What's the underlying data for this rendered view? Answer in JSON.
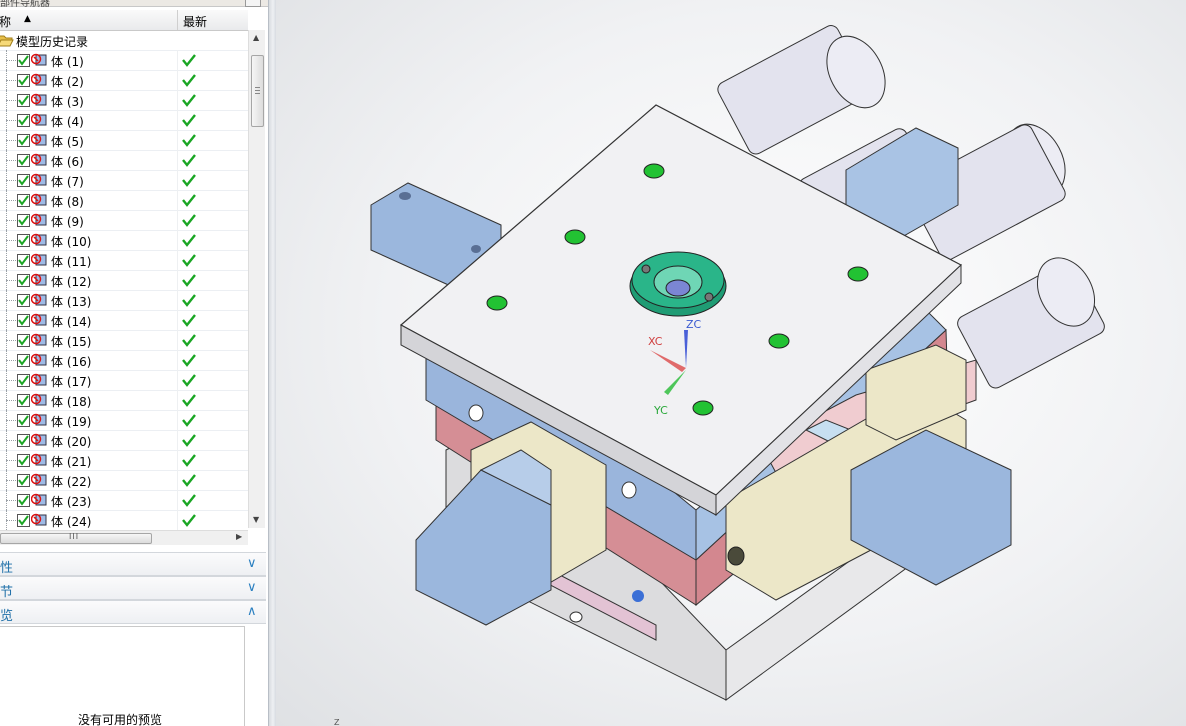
{
  "nav_title": "部件导航器",
  "tree_header": {
    "name_col": "名称",
    "latest_col": "最新"
  },
  "root": {
    "label": "模型历史记录"
  },
  "bodies": [
    {
      "label": "体 (1)"
    },
    {
      "label": "体 (2)"
    },
    {
      "label": "体 (3)"
    },
    {
      "label": "体 (4)"
    },
    {
      "label": "体 (5)"
    },
    {
      "label": "体 (6)"
    },
    {
      "label": "体 (7)"
    },
    {
      "label": "体 (8)"
    },
    {
      "label": "体 (9)"
    },
    {
      "label": "体 (10)"
    },
    {
      "label": "体 (11)"
    },
    {
      "label": "体 (12)"
    },
    {
      "label": "体 (13)"
    },
    {
      "label": "体 (14)"
    },
    {
      "label": "体 (15)"
    },
    {
      "label": "体 (16)"
    },
    {
      "label": "体 (17)"
    },
    {
      "label": "体 (18)"
    },
    {
      "label": "体 (19)"
    },
    {
      "label": "体 (20)"
    },
    {
      "label": "体 (21)"
    },
    {
      "label": "体 (22)"
    },
    {
      "label": "体 (23)"
    },
    {
      "label": "体 (24)"
    }
  ],
  "panels": [
    {
      "label": "相依性",
      "expanded": false
    },
    {
      "label": "细节",
      "expanded": false
    },
    {
      "label": "预览",
      "expanded": true
    }
  ],
  "preview_empty_text": "没有可用的预览",
  "axes": {
    "xc": "XC",
    "yc": "YC",
    "zc": "ZC",
    "corner": "Z"
  },
  "colors": {
    "plate_top": "#ecedef",
    "plate_blue": "#9db8dc",
    "plate_red": "#d88c92",
    "plate_beige": "#ece7c8",
    "cylinder": "#e6e6f0",
    "screw": "#22c233",
    "locating_ring": "#2ab589",
    "check_green": "#1aa624",
    "link_blue": "#1e6fa8"
  }
}
